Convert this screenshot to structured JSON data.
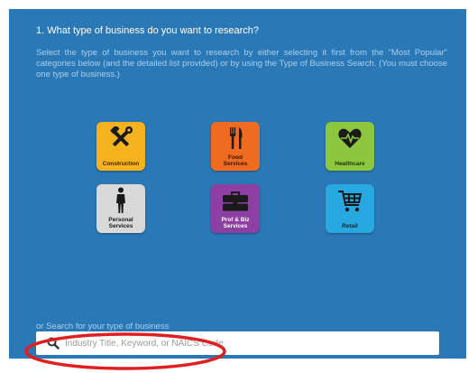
{
  "section": {
    "heading": "1. What type of business do you want to research?",
    "description": "Select the type of business you want to research by either selecting it first from the \"Most Popular\" categories below (and the detailed list provided) or by using the Type of Business Search. (You must choose one type of business.)"
  },
  "categories": [
    {
      "label": "Construction",
      "icon": "tools-icon",
      "color": "#f5b21f",
      "text_color": "#3a2300"
    },
    {
      "label": "Food\nServices",
      "icon": "fork-knife-icon",
      "color": "#ee6b1f",
      "text_color": "#3a1400"
    },
    {
      "label": "Healthcare",
      "icon": "heart-pulse-icon",
      "color": "#8dc63f",
      "text_color": "#1e3300"
    },
    {
      "label": "Personal\nServices",
      "icon": "person-icon",
      "color": "#d9d9d9",
      "text_color": "#1a1a1a"
    },
    {
      "label": "Prof & Biz\nServices",
      "icon": "briefcase-icon",
      "color": "#8e3fa3",
      "text_color": "#ffffff"
    },
    {
      "label": "Retail",
      "icon": "shopping-cart-icon",
      "color": "#27a8e0",
      "text_color": "#062a3d"
    }
  ],
  "search": {
    "prompt": "or Search for your type of business",
    "placeholder": "Industry Title, Keyword, or NAICS Code",
    "value": ""
  },
  "colors": {
    "panel": "#2b78b6",
    "annotation": "#e02020"
  }
}
